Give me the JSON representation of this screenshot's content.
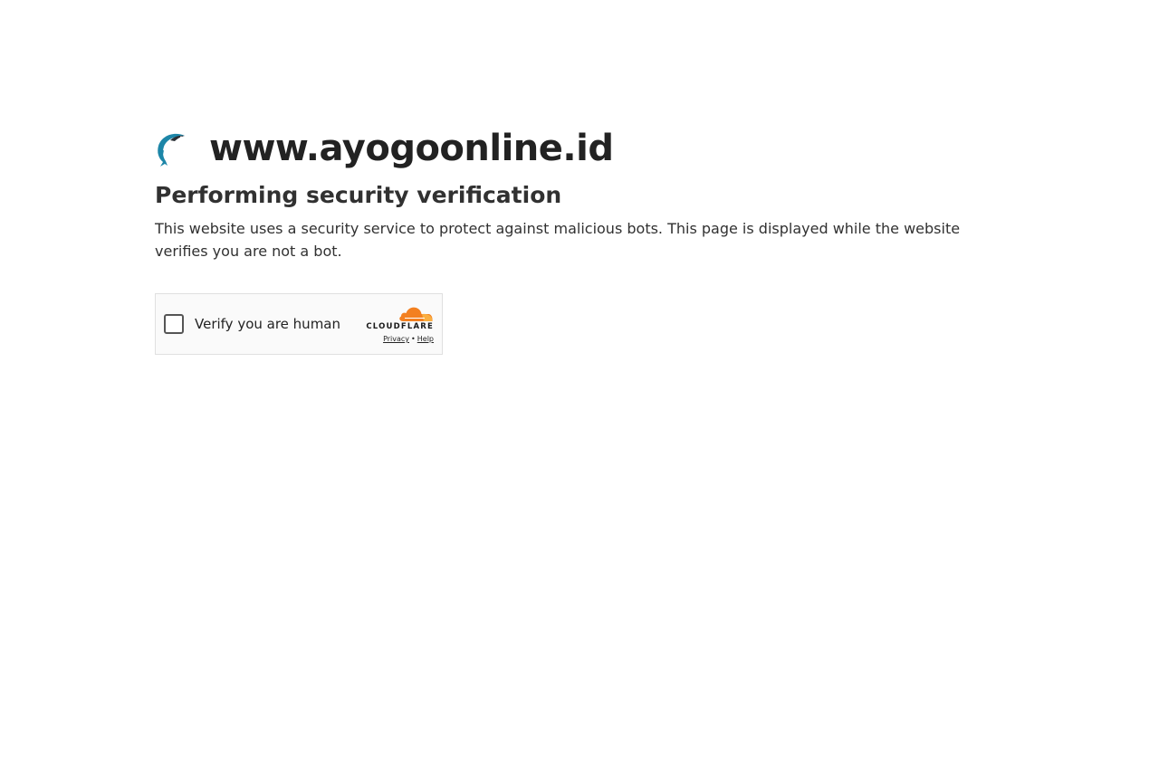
{
  "header": {
    "logo_icon": "dolphin-logo-icon",
    "site_name": "www.ayogoonline.id"
  },
  "main": {
    "heading": "Performing security verification",
    "description": "This website uses a security service to protect against malicious bots. This page is displayed while the website verifies you are not a bot."
  },
  "widget": {
    "checkbox_label": "Verify you are human",
    "checked": false,
    "brand_name": "CLOUDFLARE",
    "brand_icon": "cloudflare-cloud-icon",
    "privacy_link": "Privacy",
    "separator": "•",
    "help_link": "Help"
  },
  "colors": {
    "logo_blue": "#1d86a8",
    "cloudflare_orange": "#f38020",
    "cloudflare_light_orange": "#faae40",
    "text": "#313131"
  }
}
